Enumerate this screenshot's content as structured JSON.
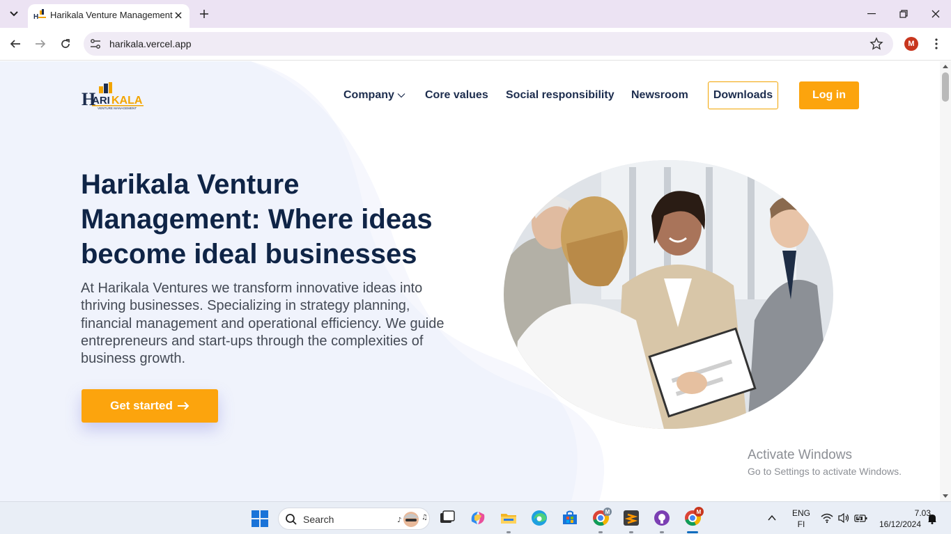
{
  "browser": {
    "tab_title": "Harikala Venture Management",
    "url": "harikala.vercel.app",
    "profile_initial": "M"
  },
  "nav": {
    "logo_text_main": "HARIKALA",
    "logo_text_sub": "VENTURE MANAGEMENT",
    "company": "Company",
    "core_values": "Core values",
    "social_responsibility": "Social responsibility",
    "newsroom": "Newsroom",
    "downloads": "Downloads",
    "login": "Log in"
  },
  "hero": {
    "title": "Harikala Venture Management: Where ideas become ideal businesses",
    "text": "At Harikala Ventures we transform innovative ideas into thriving businesses. Specializing in strategy planning, financial management and operational efficiency. We guide entrepreneurs and start-ups through the complexities of business growth.",
    "cta": "Get started"
  },
  "overlay": {
    "activate_title": "Activate Windows",
    "activate_sub": "Go to Settings to activate Windows."
  },
  "taskbar": {
    "search_label": "Search",
    "lang_top": "ENG",
    "lang_bottom": "FI",
    "time": "7.03",
    "date": "16/12/2024",
    "chrome_badge_1": "M",
    "chrome_badge_2": "M"
  },
  "colors": {
    "accent": "#fca40d",
    "navy": "#0f2446",
    "chrome_bg": "#ece3f3"
  }
}
